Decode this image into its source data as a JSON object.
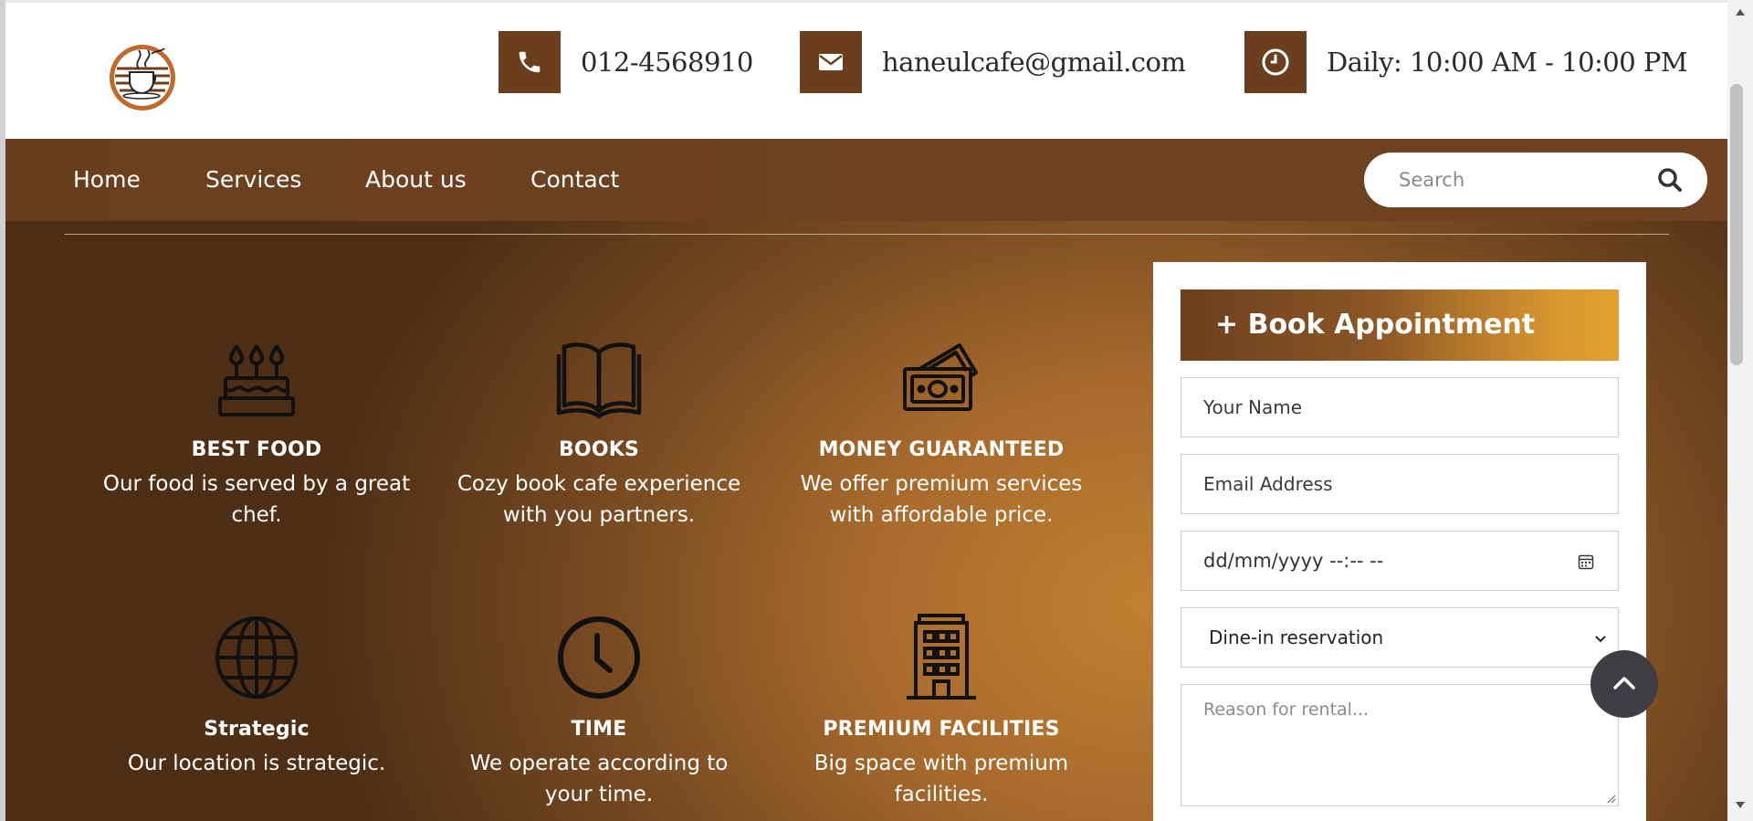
{
  "header": {
    "phone": "012-4568910",
    "email": "haneulcafe@gmail.com",
    "hours": "Daily: 10:00 AM - 10:00 PM"
  },
  "nav": {
    "items": [
      {
        "label": "Home"
      },
      {
        "label": "Services"
      },
      {
        "label": "About us"
      },
      {
        "label": "Contact"
      }
    ],
    "search_placeholder": "Search"
  },
  "features": [
    {
      "icon": "cake-icon",
      "title": "BEST FOOD",
      "desc": "Our food is served by a great chef."
    },
    {
      "icon": "book-icon",
      "title": "BOOKS",
      "desc": "Cozy book cafe experience with you partners."
    },
    {
      "icon": "money-icon",
      "title": "MONEY GUARANTEED",
      "desc": "We offer premium services with affordable price."
    },
    {
      "icon": "globe-icon",
      "title": "Strategic",
      "desc": "Our location is strategic."
    },
    {
      "icon": "clock-icon",
      "title": "TIME",
      "desc": "We operate according to your time."
    },
    {
      "icon": "building-icon",
      "title": "PREMIUM FACILITIES",
      "desc": "Big space with premium facilities."
    }
  ],
  "booking": {
    "title": "+ Book Appointment",
    "name_placeholder": "Your Name",
    "email_placeholder": "Email Address",
    "datetime_placeholder": "dd/mm/yyyy --:-- --",
    "selected_option": "Dine-in reservation",
    "reason_placeholder": "Reason for rental..."
  },
  "colors": {
    "brand_brown": "#6b3f1d",
    "accent_gold": "#e3a030",
    "to_top_button": "#3e3f43"
  }
}
